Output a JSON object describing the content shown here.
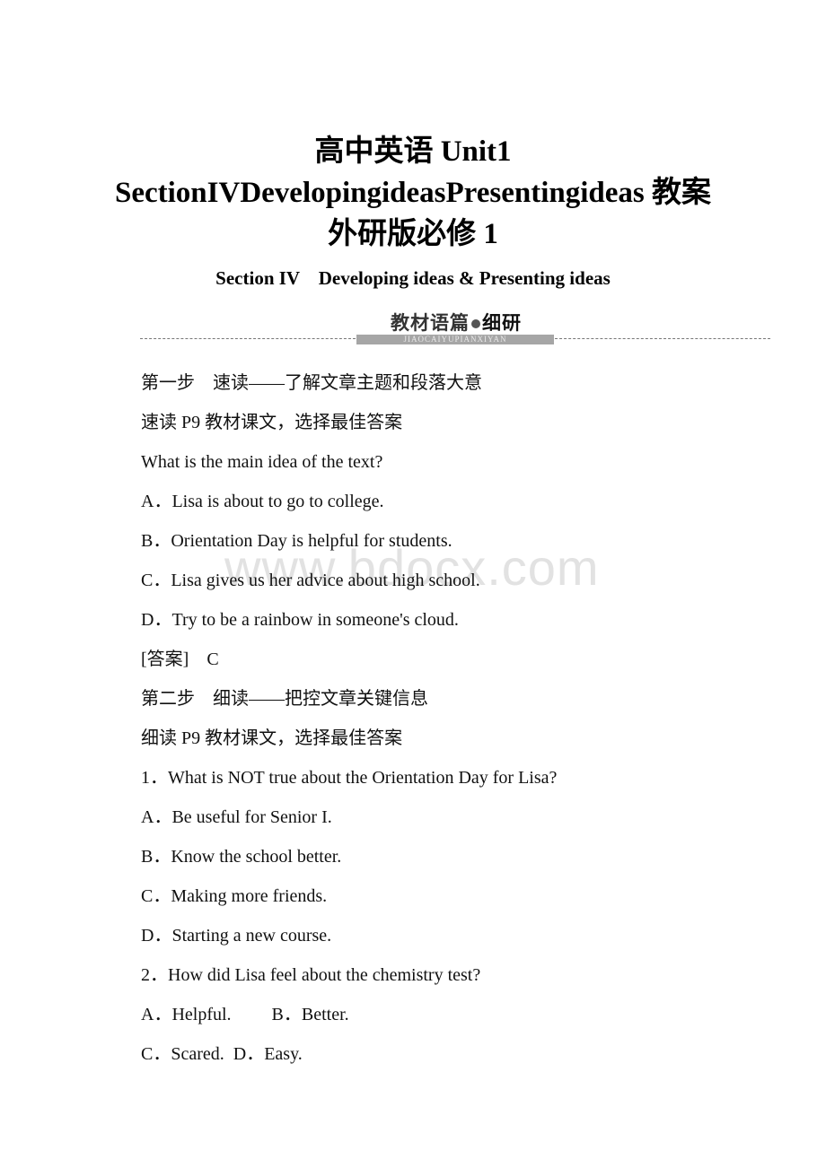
{
  "document": {
    "title_lines": [
      "高中英语 Unit1",
      "SectionIVDevelopingideasPresentingideas 教案",
      "外研版必修 1"
    ],
    "subtitle": "Section IV    Developing ideas & Presenting ideas",
    "banner": {
      "heading_part1": "教材语篇",
      "heading_part2": "细研",
      "pinyin": "JIAOCAIYUPIANXIYAN"
    },
    "watermark": "www.bdocx.com",
    "lines": [
      "第一步　速读——了解文章主题和段落大意",
      "速读 P9 教材课文，选择最佳答案",
      "What is the main idea of the text?",
      "A．Lisa is about to go to college.",
      "B．Orientation Day is helpful for students.",
      "C．Lisa gives us her advice about high school.",
      "D．Try to be a rainbow in someone's cloud.",
      "[答案]　C",
      "第二步　细读——把控文章关键信息",
      "细读 P9 教材课文，选择最佳答案",
      "1．What is NOT true about the Orientation Day for Lisa?",
      "A．Be useful for Senior I.",
      "B．Know the school better.",
      "C．Making more friends.",
      "D．Starting a new course.",
      "2．How did Lisa feel about the chemistry test?",
      "A．Helpful.　　 B．Better.",
      "C．Scared.  D．Easy."
    ]
  }
}
